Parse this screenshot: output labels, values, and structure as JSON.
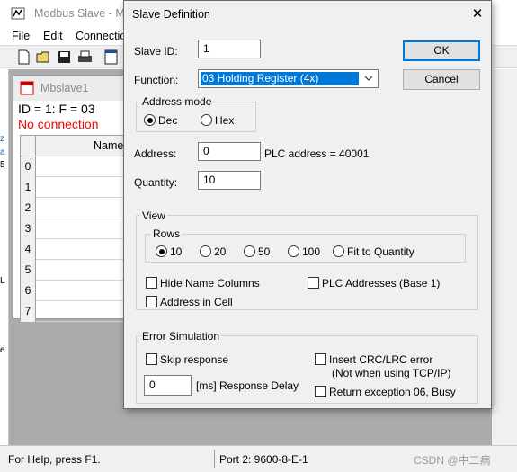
{
  "app": {
    "title": "Modbus Slave - M",
    "menu": [
      "File",
      "Edit",
      "Connection"
    ],
    "toolbar_icons": [
      "new-file-icon",
      "open-folder-icon",
      "save-icon",
      "print-icon",
      "window-icon"
    ]
  },
  "child": {
    "title": "Mbslave1",
    "line1": "ID = 1: F = 03",
    "line2": "No connection",
    "column_header": "Name",
    "rows": [
      "0",
      "1",
      "2",
      "3",
      "4",
      "5",
      "6",
      "7"
    ]
  },
  "left_strip": [
    "z",
    "a",
    "5",
    "L",
    "e"
  ],
  "statusbar": {
    "help": "For Help, press F1.",
    "port": "Port 2: 9600-8-E-1"
  },
  "watermark": "CSDN @中二病",
  "dialog": {
    "title": "Slave Definition",
    "close_glyph": "✕",
    "slave_id_label": "Slave ID:",
    "slave_id": "1",
    "function_label": "Function:",
    "function": "03 Holding Register (4x)",
    "ok": "OK",
    "cancel": "Cancel",
    "address_mode": {
      "title": "Address mode",
      "options": [
        "Dec",
        "Hex"
      ],
      "selected": "Dec"
    },
    "address_label": "Address:",
    "address": "0",
    "plc_address": "PLC address = 40001",
    "quantity_label": "Quantity:",
    "quantity": "10",
    "view": {
      "title": "View",
      "rows_title": "Rows",
      "row_options": [
        "10",
        "20",
        "50",
        "100",
        "Fit to Quantity"
      ],
      "selected_rows": "10",
      "hide_name_columns": "Hide Name Columns",
      "plc_addresses": "PLC Addresses (Base 1)",
      "address_in_cell": "Address in Cell"
    },
    "error_simulation": {
      "title": "Error Simulation",
      "skip_response": "Skip response",
      "response_delay": "0",
      "response_delay_label": "[ms] Response Delay",
      "insert_crc": "Insert CRC/LRC error",
      "insert_crc_note": "(Not when using TCP/IP)",
      "return_exception": "Return exception 06, Busy"
    }
  }
}
